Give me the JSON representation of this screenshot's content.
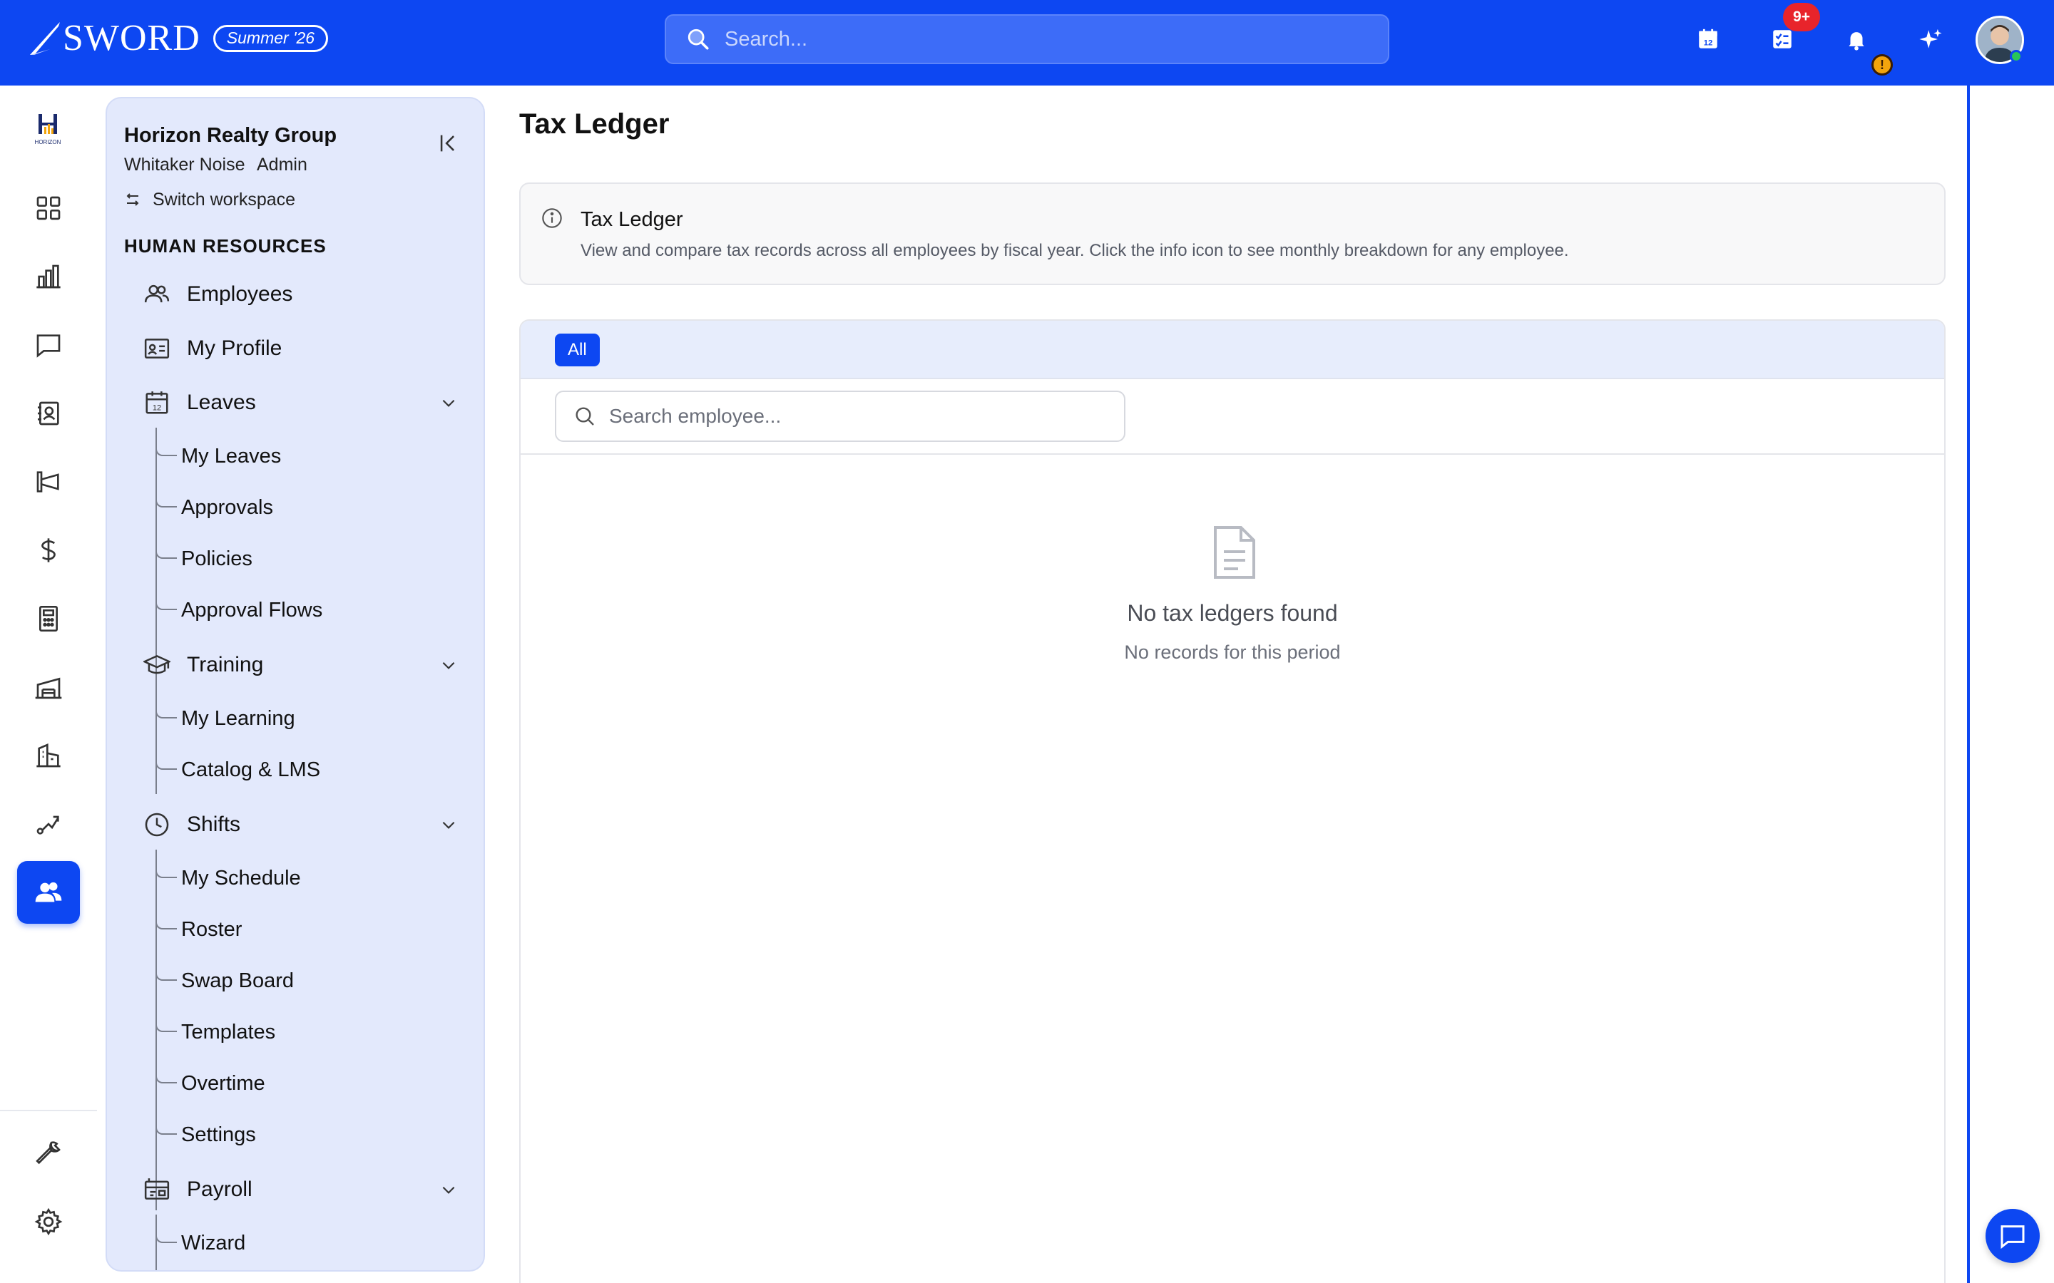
{
  "brand": {
    "name": "SWORD",
    "season": "Summer '26"
  },
  "global_search": {
    "placeholder": "Search..."
  },
  "header": {
    "tasks_badge": "9+",
    "alert_badge": "!"
  },
  "workspace": {
    "name": "Horizon Realty Group",
    "user": "Whitaker Noise",
    "role": "Admin",
    "switch_label": "Switch workspace",
    "logo_text": "HORIZON"
  },
  "sidenav": {
    "section_title": "HUMAN RESOURCES",
    "employees": "Employees",
    "my_profile": "My Profile",
    "leaves": {
      "label": "Leaves",
      "children": [
        "My Leaves",
        "Approvals",
        "Policies",
        "Approval Flows"
      ]
    },
    "training": {
      "label": "Training",
      "children": [
        "My Learning",
        "Catalog & LMS"
      ]
    },
    "shifts": {
      "label": "Shifts",
      "children": [
        "My Schedule",
        "Roster",
        "Swap Board",
        "Templates",
        "Overtime",
        "Settings"
      ]
    },
    "payroll": {
      "label": "Payroll",
      "children": [
        "Wizard"
      ]
    }
  },
  "rail_icons": [
    "dashboard-icon",
    "analytics-icon",
    "messages-icon",
    "contacts-icon",
    "marketing-icon",
    "finance-icon",
    "calculator-icon",
    "warehouse-icon",
    "buildings-icon",
    "workflow-icon",
    "people-icon",
    "wrench-icon",
    "settings-icon"
  ],
  "page": {
    "title": "Tax Ledger",
    "info_title": "Tax Ledger",
    "info_desc": "View and compare tax records across all employees by fiscal year. Click the info icon to see monthly breakdown for any employee.",
    "filter_all": "All",
    "employee_search_placeholder": "Search employee...",
    "empty_title": "No tax ledgers found",
    "empty_subtitle": "No records for this period"
  },
  "colors": {
    "primary": "#0d47f2",
    "sidenav_bg": "#e3e9fc",
    "badge_red": "#e8242b",
    "status_green": "#29c45a"
  }
}
